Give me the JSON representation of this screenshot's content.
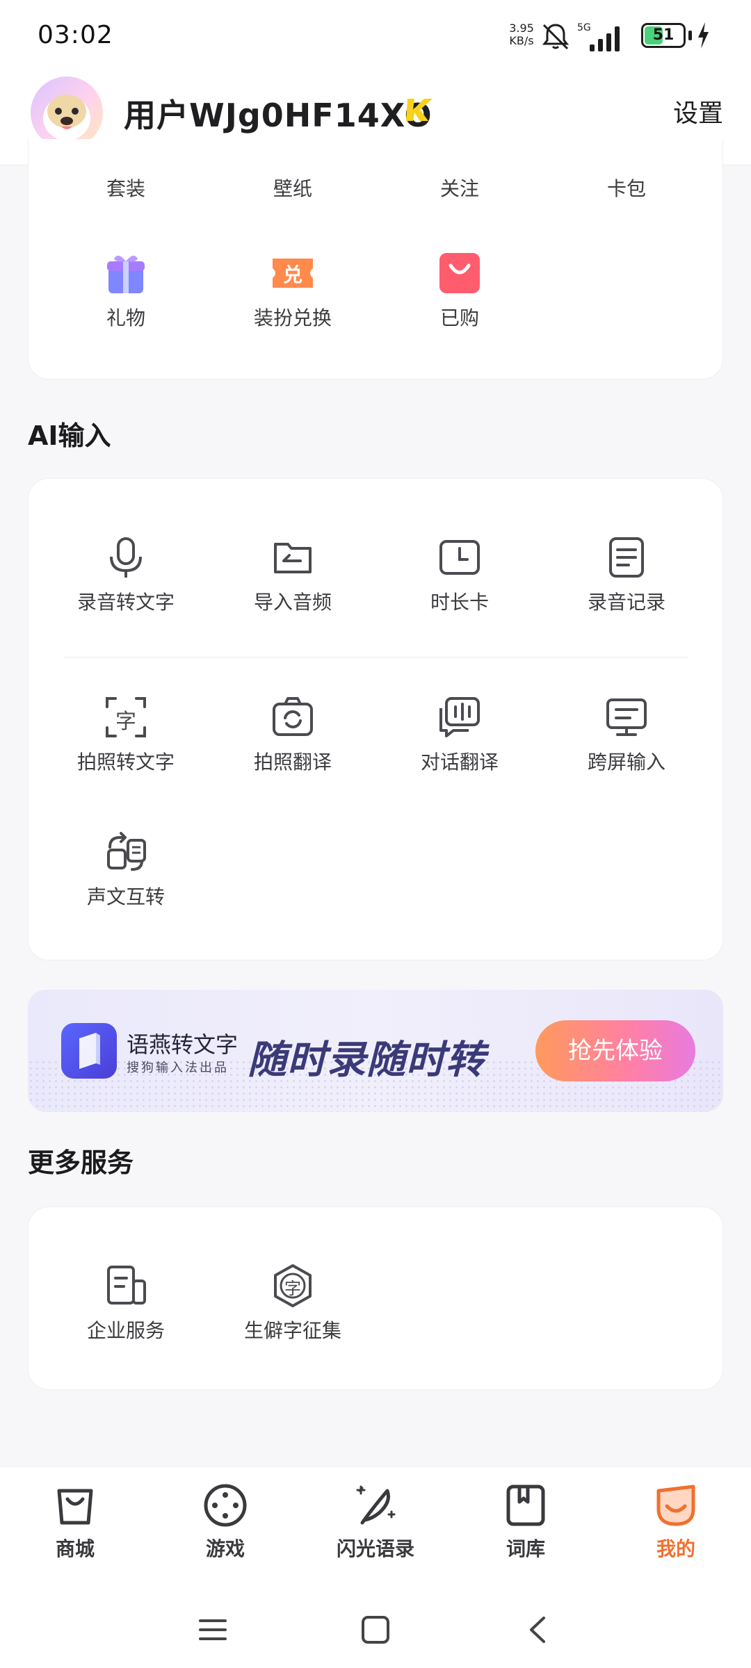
{
  "status_bar": {
    "time": "03:02",
    "net_speed_value": "3.95",
    "net_speed_unit": "KB/s",
    "network_type": "5G",
    "battery_level": "51",
    "battery_fraction": 0.51,
    "icons": [
      "bell-mute-icon",
      "signal-icon",
      "battery-icon",
      "charging-icon"
    ]
  },
  "header": {
    "username": "用户WJg0HF14XO",
    "vip_badge": "K",
    "settings_label": "设置"
  },
  "top_card": {
    "row1": [
      {
        "label": "套装"
      },
      {
        "label": "壁纸"
      },
      {
        "label": "关注"
      },
      {
        "label": "卡包"
      }
    ],
    "row2": [
      {
        "label": "礼物",
        "icon": "gift-icon"
      },
      {
        "label": "装扮兑换",
        "icon": "redeem-icon",
        "glyph": "兑"
      },
      {
        "label": "已购",
        "icon": "purchased-bag-icon"
      }
    ]
  },
  "ai_section": {
    "title": "AI输入",
    "items": [
      {
        "label": "录音转文字",
        "icon": "microphone-icon"
      },
      {
        "label": "导入音频",
        "icon": "folder-import-icon"
      },
      {
        "label": "时长卡",
        "icon": "clock-card-icon"
      },
      {
        "label": "录音记录",
        "icon": "record-list-icon"
      },
      {
        "label": "拍照转文字",
        "icon": "photo-text-icon",
        "glyph": "字"
      },
      {
        "label": "拍照翻译",
        "icon": "camera-translate-icon"
      },
      {
        "label": "对话翻译",
        "icon": "dialog-translate-icon"
      },
      {
        "label": "跨屏输入",
        "icon": "cross-screen-icon"
      },
      {
        "label": "声文互转",
        "icon": "voice-text-convert-icon"
      }
    ]
  },
  "banner": {
    "brand": "语燕转文字",
    "sub": "搜狗输入法出品",
    "slogan": "随时录随时转",
    "cta": "抢先体验"
  },
  "more_section": {
    "title": "更多服务",
    "items": [
      {
        "label": "企业服务",
        "icon": "enterprise-icon"
      },
      {
        "label": "生僻字征集",
        "icon": "rare-char-icon",
        "glyph": "字"
      }
    ]
  },
  "bottom_nav": {
    "items": [
      {
        "label": "商城",
        "icon": "shop-bag-icon"
      },
      {
        "label": "游戏",
        "icon": "game-icon"
      },
      {
        "label": "闪光语录",
        "icon": "quill-icon"
      },
      {
        "label": "词库",
        "icon": "dictionary-icon"
      },
      {
        "label": "我的",
        "icon": "my-profile-icon",
        "active": true
      }
    ],
    "accent_color": "#f0702f"
  },
  "system_nav": {
    "icons": [
      "menu-icon",
      "home-icon",
      "back-icon"
    ]
  }
}
